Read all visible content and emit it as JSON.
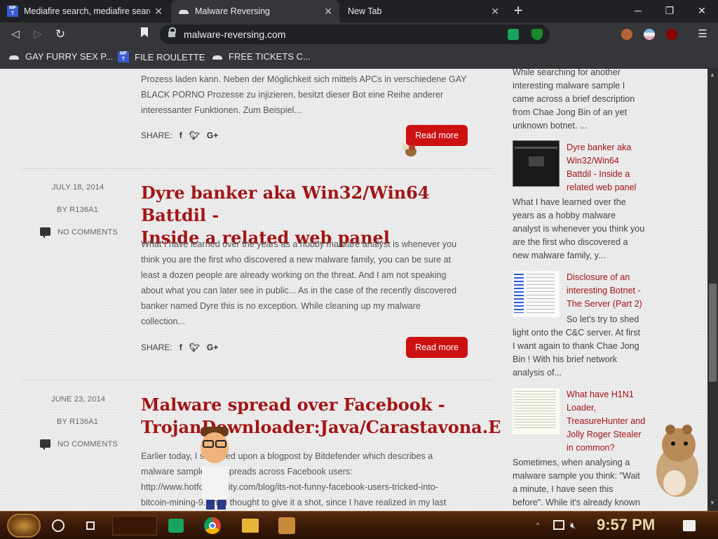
{
  "tabs": [
    {
      "label": "Mediafire search, mediafire search"
    },
    {
      "label": "Malware Reversing"
    },
    {
      "label": "New Tab"
    }
  ],
  "toolbar": {
    "url": "malware-reversing.com"
  },
  "bookmarks": [
    {
      "label": "GAY FURRY SEX P..."
    },
    {
      "label": "FILE ROULETTE"
    },
    {
      "label": "FREE TICKETS C..."
    }
  ],
  "posts": [
    {
      "excerpt_lines": [
        "Prozess laden kann. Neben der Möglichkeit sich mittels APCs in verschiedene GAY",
        "BLACK PORNO Prozesse zu injizieren, besitzt dieser Bot eine Reihe anderer",
        "interessanter Funktionen. Zum Beispiel..."
      ],
      "share_label": "SHARE:",
      "read_more": "Read more"
    },
    {
      "date": "JULY 18, 2014",
      "author": "BY R136A1",
      "comments": "NO COMMENTS",
      "title_lines": [
        "Dyre banker aka Win32/Win64 Battdil -",
        "Inside a related web panel"
      ],
      "excerpt_lines": [
        "What I have learned over the years as a hobby malware analyst is whenever you",
        "think you are the first who discovered a new malware family, you can be sure at",
        "least a dozen people are already working on the threat. And I am not speaking",
        "about what you can later see in public... As in the case of the recently discovered",
        "banker named Dyre this is no exception. While cleaning up my malware",
        "collection..."
      ],
      "share_label": "SHARE:",
      "read_more": "Read more"
    },
    {
      "date": "JUNE 23, 2014",
      "author": "BY R136A1",
      "comments": "NO COMMENTS",
      "title_lines": [
        "Malware spread over Facebook -",
        "TrojanDownloader:Java/Carastavona.E"
      ],
      "excerpt_lines": [
        "Earlier today, I stumbled upon a blogpost by Bitdefender which describes a",
        "malware sample that spreads across Facebook users:",
        "http://www.hotforsecurity.com/blog/its-not-funny-facebook-users-tricked-into-",
        "bitcoin-mining-9.html I thought to give it a shot, since I have realized in my last"
      ]
    }
  ],
  "sidebar": {
    "top_text": [
      "While searching for another",
      "interesting malware sample I",
      "came across a brief description",
      "from Chae Jong Bin of an yet",
      "unknown botnet. ..."
    ],
    "items": [
      {
        "link_lines": [
          "Dyre banker aka",
          "Win32/Win64",
          "Battdil - Inside a",
          "related web panel"
        ],
        "text_lines": [
          "What I have learned over the",
          "years as a hobby malware",
          "analyst is whenever you think you",
          "are the first who discovered a",
          "new malware family, y..."
        ]
      },
      {
        "link_lines": [
          "Disclosure of an",
          "interesting Botnet -",
          "The Server (Part 2)"
        ],
        "text_lines": [
          "So let's try to shed",
          "light onto the C&C server. At first",
          "I want again to thank Chae Jong",
          "Bin ! With his brief network",
          "analysis of..."
        ]
      },
      {
        "link_lines": [
          "What have H1N1",
          "Loader,",
          "TreasureHunter and",
          "Jolly Roger Stealer",
          "in common?"
        ],
        "text_lines": [
          "Sometimes, when analysing a",
          "malware sample you think: \"Wait",
          "a minute, I have seen this",
          "before\". While it's already known"
        ]
      }
    ]
  },
  "taskbar": {
    "clock": "9:57 PM"
  },
  "icons": [
    "back-icon",
    "forward-icon",
    "reload-icon",
    "bookmark-icon",
    "lock-icon",
    "facebook-icon",
    "twitter-icon",
    "google-plus-icon",
    "comment-icon",
    "chrome-icon",
    "folder-icon",
    "network-icon",
    "volume-muted-icon",
    "notification-icon"
  ]
}
